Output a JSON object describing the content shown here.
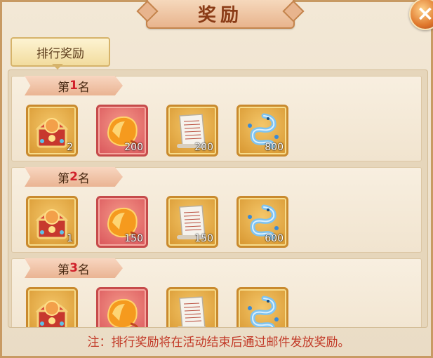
{
  "window": {
    "title": "奖励",
    "close": "×"
  },
  "tab": {
    "label": "排行奖励"
  },
  "rank_prefix": "第",
  "rank_suffix": "名",
  "ranks": [
    {
      "num": "1",
      "items": [
        {
          "icon": "treasure-chest-icon",
          "count": "2",
          "frame": "gold"
        },
        {
          "icon": "orange-gem-icon",
          "count": "200",
          "frame": "red"
        },
        {
          "icon": "scroll-icon",
          "count": "200",
          "frame": "gold"
        },
        {
          "icon": "blue-dragon-icon",
          "count": "800",
          "frame": "gold"
        }
      ]
    },
    {
      "num": "2",
      "items": [
        {
          "icon": "treasure-chest-icon",
          "count": "1",
          "frame": "gold"
        },
        {
          "icon": "orange-gem-icon",
          "count": "150",
          "frame": "red"
        },
        {
          "icon": "scroll-icon",
          "count": "150",
          "frame": "gold"
        },
        {
          "icon": "blue-dragon-icon",
          "count": "600",
          "frame": "gold"
        }
      ]
    },
    {
      "num": "3",
      "items": [
        {
          "icon": "treasure-chest-icon",
          "count": "",
          "frame": "gold"
        },
        {
          "icon": "orange-gem-icon",
          "count": "",
          "frame": "red"
        },
        {
          "icon": "scroll-icon",
          "count": "",
          "frame": "gold"
        },
        {
          "icon": "blue-dragon-icon",
          "count": "",
          "frame": "gold"
        }
      ]
    }
  ],
  "note": "注：排行奖励将在活动结束后通过邮件发放奖励。"
}
